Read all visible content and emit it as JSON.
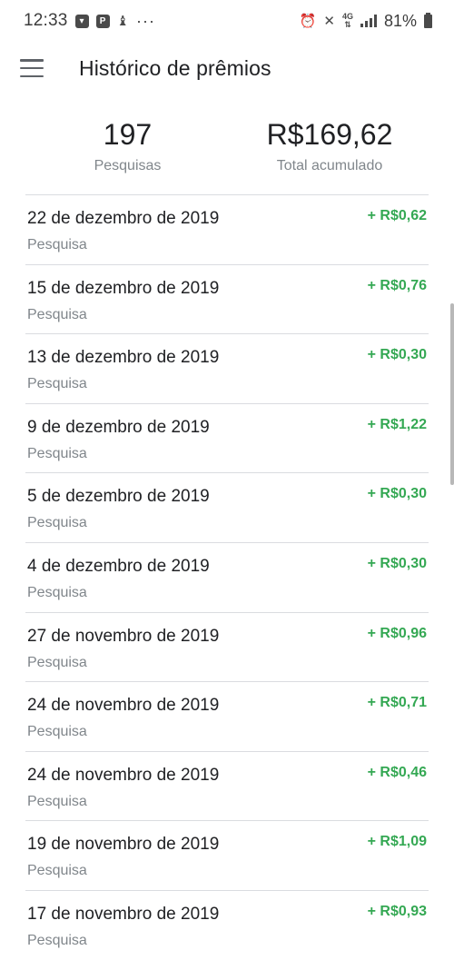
{
  "status_bar": {
    "time": "12:33",
    "battery_text": "81%",
    "network_label": "4G"
  },
  "app_bar": {
    "title": "Histórico de prêmios"
  },
  "summary": {
    "count_value": "197",
    "count_label": "Pesquisas",
    "total_value": "R$169,62",
    "total_label": "Total acumulado"
  },
  "history": [
    {
      "date": "22 de dezembro de 2019",
      "type": "Pesquisa",
      "amount": "+ R$0,62"
    },
    {
      "date": "15 de dezembro de 2019",
      "type": "Pesquisa",
      "amount": "+ R$0,76"
    },
    {
      "date": "13 de dezembro de 2019",
      "type": "Pesquisa",
      "amount": "+ R$0,30"
    },
    {
      "date": "9 de dezembro de 2019",
      "type": "Pesquisa",
      "amount": "+ R$1,22"
    },
    {
      "date": "5 de dezembro de 2019",
      "type": "Pesquisa",
      "amount": "+ R$0,30"
    },
    {
      "date": "4 de dezembro de 2019",
      "type": "Pesquisa",
      "amount": "+ R$0,30"
    },
    {
      "date": "27 de novembro de 2019",
      "type": "Pesquisa",
      "amount": "+ R$0,96"
    },
    {
      "date": "24 de novembro de 2019",
      "type": "Pesquisa",
      "amount": "+ R$0,71"
    },
    {
      "date": "24 de novembro de 2019",
      "type": "Pesquisa",
      "amount": "+ R$0,46"
    },
    {
      "date": "19 de novembro de 2019",
      "type": "Pesquisa",
      "amount": "+ R$1,09"
    },
    {
      "date": "17 de novembro de 2019",
      "type": "Pesquisa",
      "amount": "+ R$0,93"
    }
  ],
  "colors": {
    "amount_positive": "#34a853",
    "text_primary": "#202124",
    "text_secondary": "#80868b",
    "divider": "#dadce0"
  }
}
